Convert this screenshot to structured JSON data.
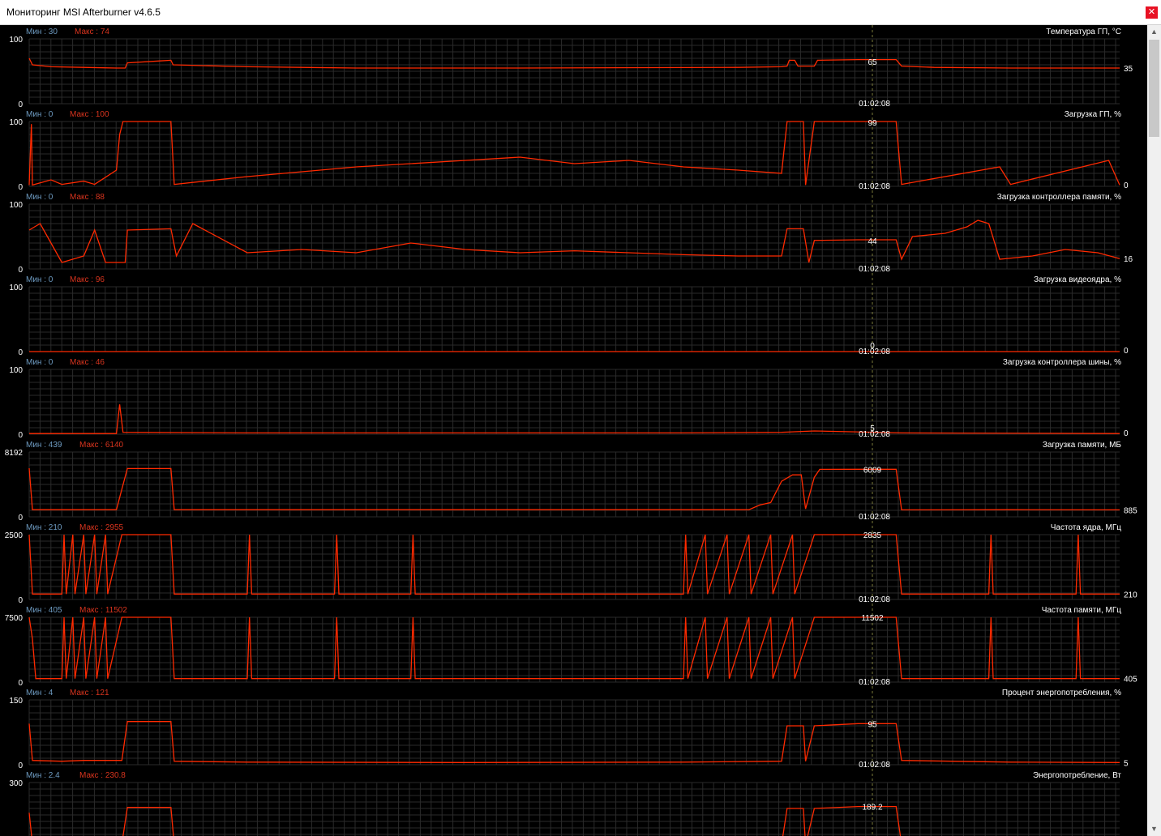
{
  "window": {
    "title": "Мониторинг MSI Afterburner v4.6.5",
    "close_glyph": "✕"
  },
  "cursor_time": "01:02:08",
  "colors": {
    "line": "#ff2a00",
    "grid": "#2a2a2a",
    "min_label": "#6d9ac0",
    "max_label": "#d8341e",
    "text": "#ffffff"
  },
  "graphs": [
    {
      "name": "Температура ГП, °C",
      "min_label": "Мин : 30",
      "max_label": "Макс : 74",
      "y_max": "100",
      "y_min": "0",
      "cursor_value": "65",
      "current": "35",
      "series": [
        [
          0,
          70
        ],
        [
          0.3,
          60
        ],
        [
          2,
          57
        ],
        [
          5,
          56
        ],
        [
          8,
          55
        ],
        [
          8.8,
          55
        ],
        [
          9,
          63
        ],
        [
          12,
          66
        ],
        [
          13,
          67
        ],
        [
          13.2,
          60
        ],
        [
          20,
          57
        ],
        [
          30,
          55
        ],
        [
          45,
          55
        ],
        [
          65,
          56
        ],
        [
          69,
          57
        ],
        [
          69.5,
          58
        ],
        [
          69.7,
          67
        ],
        [
          70.2,
          67
        ],
        [
          70.5,
          58
        ],
        [
          72,
          58
        ],
        [
          72.3,
          67
        ],
        [
          76,
          68
        ],
        [
          79.5,
          68
        ],
        [
          80,
          58
        ],
        [
          83,
          56
        ],
        [
          90,
          55
        ],
        [
          100,
          55
        ]
      ]
    },
    {
      "name": "Загрузка ГП, %",
      "min_label": "Мин : 0",
      "max_label": "Макс : 100",
      "y_max": "100",
      "y_min": "0",
      "cursor_value": "99",
      "current": "0",
      "series": [
        [
          0,
          2
        ],
        [
          0.2,
          96
        ],
        [
          0.3,
          2
        ],
        [
          2,
          10
        ],
        [
          3,
          3
        ],
        [
          5,
          8
        ],
        [
          6,
          3
        ],
        [
          8,
          25
        ],
        [
          8.3,
          80
        ],
        [
          8.6,
          100
        ],
        [
          13,
          100
        ],
        [
          13.3,
          3
        ],
        [
          20,
          15
        ],
        [
          30,
          30
        ],
        [
          40,
          40
        ],
        [
          45,
          45
        ],
        [
          50,
          35
        ],
        [
          55,
          40
        ],
        [
          60,
          30
        ],
        [
          65,
          25
        ],
        [
          69,
          20
        ],
        [
          69.5,
          100
        ],
        [
          71,
          100
        ],
        [
          71.2,
          2
        ],
        [
          72,
          100
        ],
        [
          79.5,
          100
        ],
        [
          80,
          3
        ],
        [
          89,
          30
        ],
        [
          90,
          3
        ],
        [
          99,
          40
        ],
        [
          100,
          2
        ]
      ]
    },
    {
      "name": "Загрузка контроллера памяти, %",
      "min_label": "Мин : 0",
      "max_label": "Макс : 88",
      "y_max": "100",
      "y_min": "0",
      "cursor_value": "44",
      "current": "16",
      "series": [
        [
          0,
          60
        ],
        [
          1,
          70
        ],
        [
          2,
          40
        ],
        [
          3,
          10
        ],
        [
          5,
          20
        ],
        [
          6,
          60
        ],
        [
          7,
          10
        ],
        [
          8.8,
          10
        ],
        [
          9,
          60
        ],
        [
          13,
          62
        ],
        [
          13.5,
          20
        ],
        [
          15,
          70
        ],
        [
          20,
          25
        ],
        [
          25,
          30
        ],
        [
          30,
          25
        ],
        [
          35,
          40
        ],
        [
          40,
          30
        ],
        [
          45,
          25
        ],
        [
          50,
          28
        ],
        [
          55,
          25
        ],
        [
          60,
          22
        ],
        [
          65,
          20
        ],
        [
          69,
          20
        ],
        [
          69.5,
          62
        ],
        [
          71,
          62
        ],
        [
          71.5,
          10
        ],
        [
          72,
          44
        ],
        [
          76,
          45
        ],
        [
          79.5,
          45
        ],
        [
          80,
          15
        ],
        [
          81,
          50
        ],
        [
          84,
          55
        ],
        [
          86,
          65
        ],
        [
          87,
          75
        ],
        [
          88,
          70
        ],
        [
          89,
          15
        ],
        [
          92,
          20
        ],
        [
          95,
          30
        ],
        [
          98,
          25
        ],
        [
          100,
          16
        ]
      ]
    },
    {
      "name": "Загрузка видеоядра, %",
      "min_label": "Мин : 0",
      "max_label": "Макс : 96",
      "y_max": "100",
      "y_min": "0",
      "cursor_value": "0",
      "current": "0",
      "series": [
        [
          0,
          0
        ],
        [
          100,
          0
        ]
      ]
    },
    {
      "name": "Загрузка контроллера шины, %",
      "min_label": "Мин : 0",
      "max_label": "Макс : 46",
      "y_max": "100",
      "y_min": "0",
      "cursor_value": "5",
      "current": "0",
      "series": [
        [
          0,
          1
        ],
        [
          8,
          1
        ],
        [
          8.3,
          46
        ],
        [
          8.6,
          3
        ],
        [
          20,
          2
        ],
        [
          40,
          2
        ],
        [
          60,
          2
        ],
        [
          69,
          3
        ],
        [
          72,
          5
        ],
        [
          80,
          2
        ],
        [
          100,
          1
        ]
      ]
    },
    {
      "name": "Загрузка памяти, МБ",
      "min_label": "Мин : 439",
      "max_label": "Макс : 6140",
      "y_max": "8192",
      "y_min": "0",
      "cursor_value": "6009",
      "current": "885",
      "series": [
        [
          0,
          6140
        ],
        [
          0.3,
          900
        ],
        [
          8,
          900
        ],
        [
          8.5,
          3500
        ],
        [
          9,
          6100
        ],
        [
          13,
          6100
        ],
        [
          13.3,
          900
        ],
        [
          20,
          900
        ],
        [
          30,
          900
        ],
        [
          40,
          900
        ],
        [
          50,
          900
        ],
        [
          60,
          900
        ],
        [
          66,
          900
        ],
        [
          67,
          1500
        ],
        [
          68,
          1800
        ],
        [
          69,
          4500
        ],
        [
          70,
          5300
        ],
        [
          70.8,
          5300
        ],
        [
          71.2,
          1000
        ],
        [
          72,
          5000
        ],
        [
          72.5,
          6000
        ],
        [
          76,
          6009
        ],
        [
          79.5,
          6009
        ],
        [
          80,
          885
        ],
        [
          90,
          900
        ],
        [
          100,
          885
        ]
      ]
    },
    {
      "name": "Частота ядра, МГц",
      "min_label": "Мин : 210",
      "max_label": "Макс : 2955",
      "y_max": "2500",
      "y_min": "0",
      "cursor_value": "2835",
      "current": "210",
      "series": [
        [
          0,
          2800
        ],
        [
          0.3,
          210
        ],
        [
          3,
          210
        ],
        [
          3.2,
          2800
        ],
        [
          3.4,
          210
        ],
        [
          4,
          2800
        ],
        [
          4.2,
          210
        ],
        [
          5,
          2800
        ],
        [
          5.2,
          210
        ],
        [
          6,
          2800
        ],
        [
          6.2,
          210
        ],
        [
          7,
          2800
        ],
        [
          7.2,
          210
        ],
        [
          8.5,
          2800
        ],
        [
          13,
          2800
        ],
        [
          13.3,
          210
        ],
        [
          20,
          210
        ],
        [
          20.2,
          2800
        ],
        [
          20.4,
          210
        ],
        [
          28,
          210
        ],
        [
          28.2,
          2800
        ],
        [
          28.4,
          210
        ],
        [
          35,
          210
        ],
        [
          35.2,
          2800
        ],
        [
          35.4,
          210
        ],
        [
          60,
          210
        ],
        [
          60.2,
          2800
        ],
        [
          60.4,
          210
        ],
        [
          62,
          2800
        ],
        [
          62.2,
          210
        ],
        [
          64,
          2800
        ],
        [
          64.2,
          210
        ],
        [
          66,
          2800
        ],
        [
          66.2,
          210
        ],
        [
          68,
          2800
        ],
        [
          68.2,
          210
        ],
        [
          70,
          2800
        ],
        [
          70.2,
          210
        ],
        [
          72,
          2835
        ],
        [
          79.5,
          2835
        ],
        [
          80,
          210
        ],
        [
          88,
          210
        ],
        [
          88.2,
          2800
        ],
        [
          88.4,
          210
        ],
        [
          96,
          210
        ],
        [
          96.2,
          2800
        ],
        [
          96.4,
          210
        ],
        [
          100,
          210
        ]
      ]
    },
    {
      "name": "Частота памяти, МГц",
      "min_label": "Мин : 405",
      "max_label": "Макс : 11502",
      "y_max": "7500",
      "y_min": "0",
      "cursor_value": "11502",
      "current": "405",
      "series": [
        [
          0,
          7500
        ],
        [
          0.3,
          5000
        ],
        [
          0.6,
          405
        ],
        [
          3,
          405
        ],
        [
          3.2,
          7500
        ],
        [
          3.4,
          405
        ],
        [
          4,
          7500
        ],
        [
          4.2,
          405
        ],
        [
          5,
          7500
        ],
        [
          5.2,
          405
        ],
        [
          6,
          7500
        ],
        [
          6.2,
          405
        ],
        [
          7,
          7500
        ],
        [
          7.2,
          405
        ],
        [
          8.5,
          7500
        ],
        [
          13,
          7500
        ],
        [
          13.3,
          405
        ],
        [
          20,
          405
        ],
        [
          20.2,
          7500
        ],
        [
          20.4,
          405
        ],
        [
          28,
          405
        ],
        [
          28.2,
          7500
        ],
        [
          28.4,
          405
        ],
        [
          35,
          405
        ],
        [
          35.2,
          7500
        ],
        [
          35.4,
          405
        ],
        [
          60,
          405
        ],
        [
          60.2,
          7500
        ],
        [
          60.4,
          405
        ],
        [
          62,
          7500
        ],
        [
          62.2,
          405
        ],
        [
          64,
          7500
        ],
        [
          64.2,
          405
        ],
        [
          66,
          7500
        ],
        [
          66.2,
          405
        ],
        [
          68,
          7500
        ],
        [
          68.2,
          405
        ],
        [
          70,
          7500
        ],
        [
          70.2,
          405
        ],
        [
          72,
          7500
        ],
        [
          79.5,
          7500
        ],
        [
          80,
          405
        ],
        [
          88,
          405
        ],
        [
          88.2,
          7500
        ],
        [
          88.4,
          405
        ],
        [
          96,
          405
        ],
        [
          96.2,
          7500
        ],
        [
          96.4,
          405
        ],
        [
          100,
          405
        ]
      ]
    },
    {
      "name": "Процент энергопотребления, %",
      "min_label": "Мин : 4",
      "max_label": "Макс : 121",
      "y_max": "150",
      "y_min": "0",
      "cursor_value": "95",
      "current": "5",
      "series": [
        [
          0,
          95
        ],
        [
          0.3,
          10
        ],
        [
          3,
          8
        ],
        [
          5,
          10
        ],
        [
          8.5,
          10
        ],
        [
          9,
          100
        ],
        [
          13,
          100
        ],
        [
          13.3,
          8
        ],
        [
          20,
          6
        ],
        [
          40,
          5
        ],
        [
          60,
          6
        ],
        [
          69,
          8
        ],
        [
          69.5,
          90
        ],
        [
          71,
          90
        ],
        [
          71.2,
          8
        ],
        [
          72,
          90
        ],
        [
          76,
          95
        ],
        [
          79.5,
          95
        ],
        [
          80,
          10
        ],
        [
          90,
          6
        ],
        [
          100,
          5
        ]
      ]
    },
    {
      "name": "Энергопотребление, Вт",
      "min_label": "Мин : 2.4",
      "max_label": "Макс : 230.8",
      "y_max": "300",
      "y_min": "",
      "cursor_value": "189.2",
      "current": "",
      "series": [
        [
          0,
          160
        ],
        [
          0.3,
          15
        ],
        [
          8.5,
          15
        ],
        [
          9,
          185
        ],
        [
          13,
          185
        ],
        [
          13.3,
          12
        ],
        [
          69,
          12
        ],
        [
          69.5,
          180
        ],
        [
          71,
          180
        ],
        [
          71.2,
          12
        ],
        [
          72,
          180
        ],
        [
          76,
          189
        ],
        [
          79.5,
          189
        ],
        [
          80,
          15
        ],
        [
          100,
          12
        ]
      ]
    }
  ]
}
